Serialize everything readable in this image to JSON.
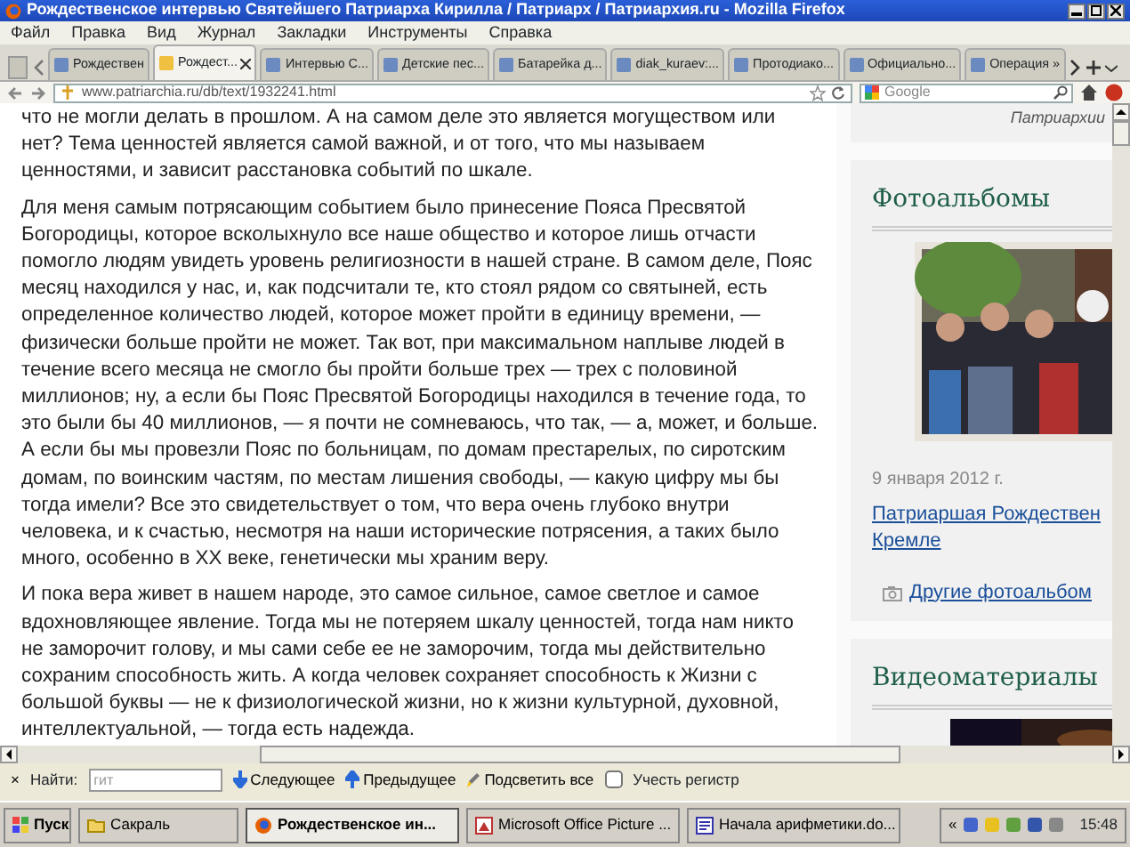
{
  "window": {
    "title": "Рождественское интервью Святейшего Патриарха Кирилла / Патриарх / Патриархия.ru - Mozilla Firefox"
  },
  "menu": [
    "Файл",
    "Правка",
    "Вид",
    "Журнал",
    "Закладки",
    "Инструменты",
    "Справка"
  ],
  "tabs": [
    {
      "label": "Рождествен",
      "selected": false
    },
    {
      "label": "Рождест...",
      "selected": true
    },
    {
      "label": "Интервью С...",
      "selected": false
    },
    {
      "label": "Детские пес...",
      "selected": false
    },
    {
      "label": "Батарейка д...",
      "selected": false
    },
    {
      "label": "diak_kuraev:...",
      "selected": false
    },
    {
      "label": "Протодиако...",
      "selected": false
    },
    {
      "label": "Официально...",
      "selected": false
    },
    {
      "label": "Операция »",
      "selected": false
    }
  ],
  "address": {
    "value": "www.patriarchia.ru/db/text/1932241.html"
  },
  "search": {
    "placeholder": "Google"
  },
  "article": {
    "paragraphs": [
      [
        "что не могли делать в прошлом. А на самом деле это является могуществом или",
        "нет? Тема ценностей является самой важной, и от того, что мы называем",
        "ценностями, и зависит расстановка событий по шкале."
      ],
      [
        "Для меня самым потрясающим событием было принесение Пояса Пресвятой",
        "Богородицы, которое всколыхнуло все наше общество и которое лишь отчасти",
        "помогло людям увидеть уровень религиозности в нашей стране. В самом деле, Пояс",
        "месяц находился у нас, и, как подсчитали те, кто стоял рядом со святыней, есть",
        "определенное количество людей, которое может пройти в единицу времени, —",
        "физически больше пройти не может. Так вот, при максимальном наплыве людей в",
        "течение всего месяца не смогло бы пройти больше трех — трех с половиной",
        "миллионов; ну, а если бы Пояс Пресвятой Богородицы находился в течение года, то",
        "это были бы 40 миллионов, — я почти не сомневаюсь, что так, — а, может, и больше.",
        "А если бы мы провезли Пояс по больницам, по домам престарелых, по сиротским",
        "домам, по воинским частям, по местам лишения свободы, — какую цифру мы бы",
        "тогда имели? Все это свидетельствует о том, что вера очень глубоко внутри",
        "человека, и к счастью, несмотря на наши исторические потрясения, а таких было",
        "много, особенно в XX веке, генетически мы храним веру."
      ],
      [
        "И пока вера живет в нашем народе, это самое сильное, самое светлое и самое",
        "вдохновляющее явление. Тогда мы не потеряем шкалу ценностей, тогда нам никто",
        "не заморочит голову, и мы сами себе ее не заморочим, тогда мы действительно",
        "сохраним способность жить. А когда человек сохраняет способность к Жизни с",
        "большой буквы — не к физиологической жизни, но к жизни культурной, духовной,",
        "интеллектуальной, — тогда есть надежда."
      ]
    ]
  },
  "sidebar": {
    "top_caption": "Патриархии",
    "photo_albums": {
      "title": "Фотоальбомы",
      "date": "9 января 2012 г.",
      "album_link": [
        "Патриаршая Рождествен",
        "Кремле"
      ],
      "more_link": "Другие фотоальбом"
    },
    "videos": {
      "title": "Видеоматериалы"
    }
  },
  "find_bar": {
    "close": "×",
    "label": "Найти:",
    "value": "гит",
    "next": "Следующее",
    "previous": "Предыдущее",
    "highlight_all": "Подсветить все",
    "match_case": {
      "label": "Учесть регистр",
      "checked": false
    }
  },
  "taskbar": {
    "start": "Пуск",
    "items": [
      {
        "label": "Сакраль",
        "selected": false
      },
      {
        "label": "Рождественское ин...",
        "selected": true
      },
      {
        "label": "Microsoft Office Picture ...",
        "selected": false
      },
      {
        "label": "Начала арифметики.do...",
        "selected": false
      }
    ],
    "tray_toggle": "«",
    "clock": "15:48"
  }
}
